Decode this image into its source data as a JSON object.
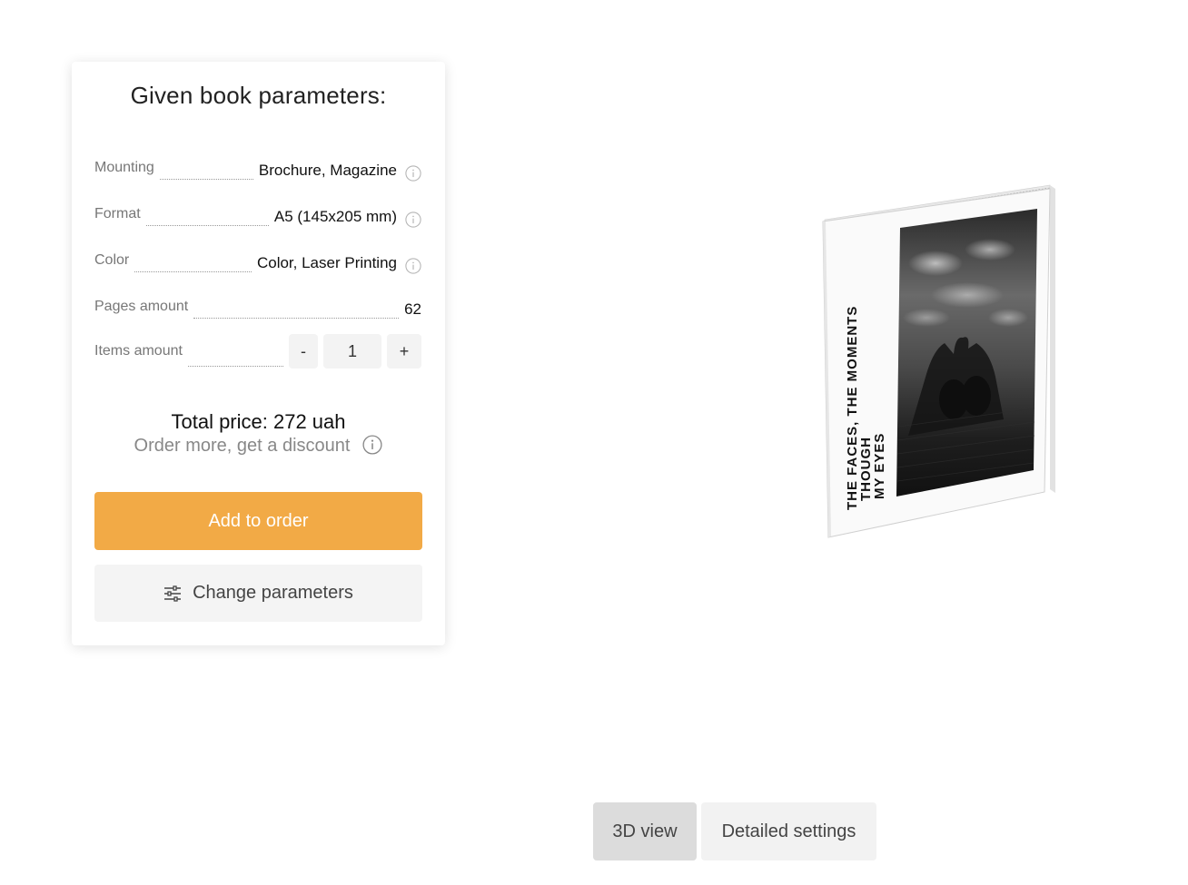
{
  "card": {
    "title": "Given book parameters:",
    "params": [
      {
        "label": "Mounting",
        "value": "Brochure, Magazine",
        "info": true
      },
      {
        "label": "Format",
        "value": "A5 (145x205 mm)",
        "info": true
      },
      {
        "label": "Color",
        "value": "Color, Laser Printing",
        "info": true
      },
      {
        "label": "Pages amount",
        "value": "62",
        "info": false
      }
    ],
    "items": {
      "label": "Items amount",
      "minus_label": "-",
      "value": "1",
      "plus_label": "+"
    },
    "total_price": "Total price: 272 uah",
    "discount_text": "Order more, get a discount",
    "add_to_order_label": "Add to order",
    "change_parameters_label": "Change parameters"
  },
  "preview": {
    "cover_text_lines": [
      "THE FACES, THE MOMENTS",
      "THOUGH",
      "MY EYES"
    ]
  },
  "tabs": [
    {
      "label": "3D view",
      "active": true
    },
    {
      "label": "Detailed settings",
      "active": false
    }
  ],
  "colors": {
    "accent": "#f2aa46",
    "active_tab": "#dcdcdc",
    "inactive_tab": "#f2f2f2"
  }
}
